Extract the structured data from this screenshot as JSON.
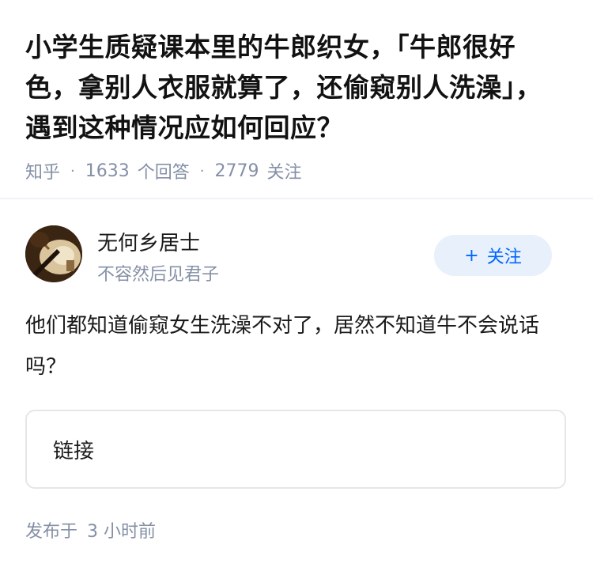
{
  "question": {
    "title": "小学生质疑课本里的牛郎织女，「牛郎很好色，拿别人衣服就算了，还偷窥别人洗澡」，遇到这种情况应如何回应？",
    "source": "知乎",
    "answer_count": "1633",
    "answer_label": "个回答",
    "follower_count": "2779",
    "follower_label": "关注"
  },
  "author": {
    "name": "无何乡居士",
    "bio": "不容然后见君子",
    "avatar_icon": "avatar-portrait"
  },
  "follow_button": {
    "icon": "+",
    "label": "关注"
  },
  "answer": {
    "text": "他们都知道偷窥女生洗澡不对了，居然不知道牛不会说话吗？"
  },
  "link_card": {
    "label": "链接"
  },
  "footer": {
    "published_label": "发布于",
    "published_time": "3 小时前"
  },
  "colors": {
    "accent": "#0066ff",
    "accent_bg": "#e8f0fb",
    "meta_text": "#8590a6",
    "divider": "#f0f2f7"
  }
}
